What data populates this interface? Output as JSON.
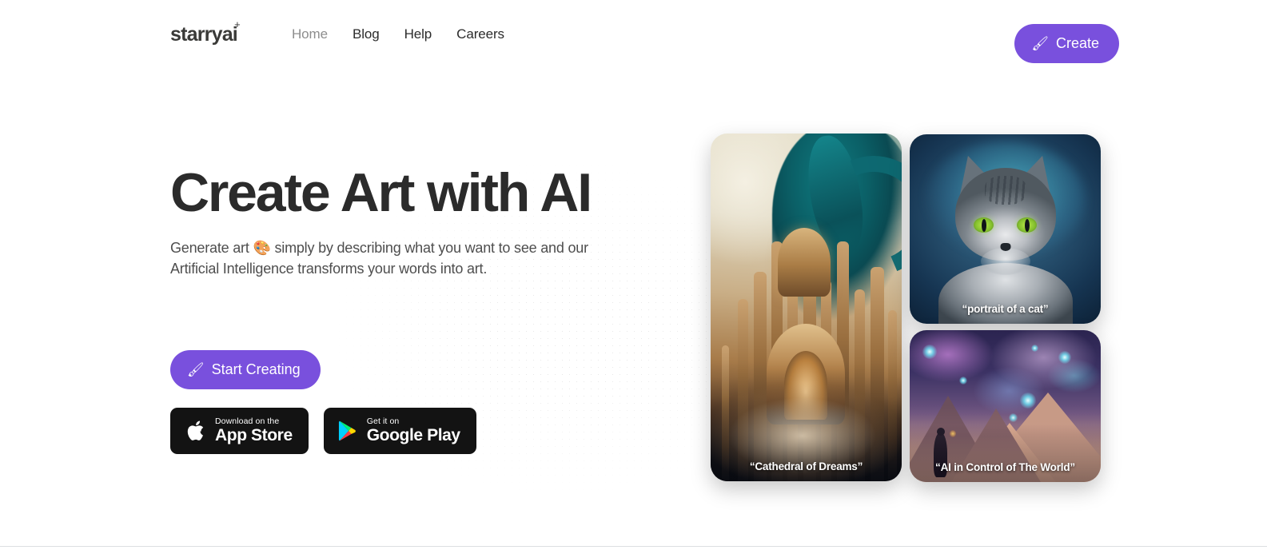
{
  "brand": {
    "logo_text": "starryai",
    "logo_star": "+",
    "accent_color": "#7950dd"
  },
  "nav": {
    "items": [
      {
        "label": "Home",
        "active": true
      },
      {
        "label": "Blog",
        "active": false
      },
      {
        "label": "Help",
        "active": false
      },
      {
        "label": "Careers",
        "active": false
      }
    ]
  },
  "header": {
    "create_button": {
      "label": "Create",
      "emoji": "🖌"
    }
  },
  "hero": {
    "title": "Create Art with AI",
    "subtitle": "Generate art 🎨 simply by describing what you want to see and our Artificial Intelligence transforms your words into art.",
    "cta": {
      "label": "Start Creating",
      "emoji": "🖌"
    },
    "app_store": {
      "small_label": "Download on the",
      "big_label": "App Store",
      "icon": "apple-icon"
    },
    "google_play": {
      "small_label": "Get it on",
      "big_label": "Google Play",
      "icon": "google-play-icon"
    }
  },
  "gallery": {
    "cards": [
      {
        "id": "cathedral",
        "caption": "“Cathedral of Dreams”",
        "alt": "ornate golden cathedral with teal creature above"
      },
      {
        "id": "cat",
        "caption": "“portrait of a cat”",
        "alt": "grey tabby cat with green eyes on blue background"
      },
      {
        "id": "cosmos",
        "caption": "“AI in Control of The World”",
        "alt": "figure on mountain under purple nebula sky"
      }
    ]
  }
}
